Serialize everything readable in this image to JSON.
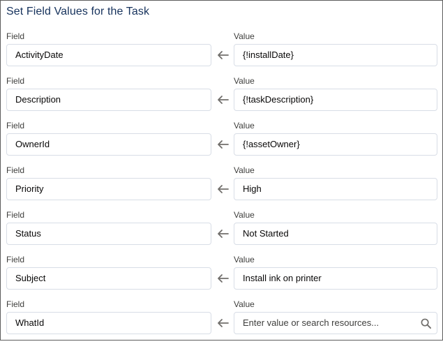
{
  "panel": {
    "title": "Set Field Values for the Task"
  },
  "labels": {
    "field": "Field",
    "value": "Value"
  },
  "rows": [
    {
      "field": "ActivityDate",
      "value": "{!installDate}"
    },
    {
      "field": "Description",
      "value": "{!taskDescription}"
    },
    {
      "field": "OwnerId",
      "value": "{!assetOwner}"
    },
    {
      "field": "Priority",
      "value": "High"
    },
    {
      "field": "Status",
      "value": "Not Started"
    },
    {
      "field": "Subject",
      "value": "Install ink on printer"
    },
    {
      "field": "WhatId",
      "value": ""
    }
  ],
  "last_value_placeholder": "Enter value or search resources...",
  "icons": {
    "assign": "left-arrow-icon",
    "search": "search-icon"
  },
  "colors": {
    "border": "#d8dde6",
    "title": "#16325c",
    "arrow": "#706e6b"
  }
}
